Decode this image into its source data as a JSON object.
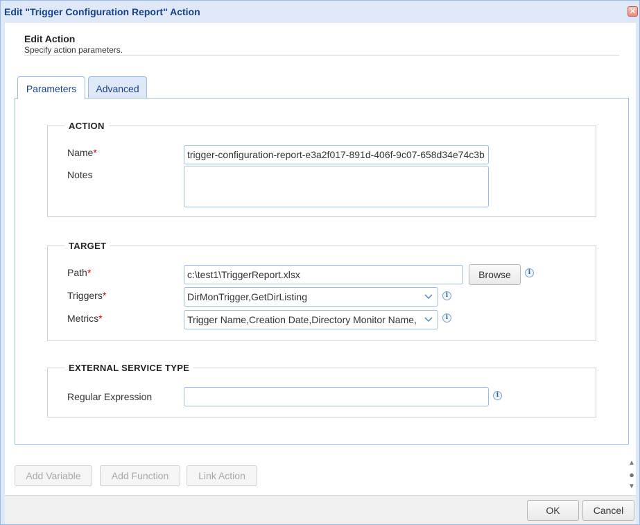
{
  "window": {
    "title": "Edit \"Trigger Configuration Report\" Action",
    "close_glyph": "✕"
  },
  "header": {
    "title": "Edit Action",
    "subtitle": "Specify action parameters."
  },
  "tabs": [
    {
      "label": "Parameters",
      "active": true
    },
    {
      "label": "Advanced",
      "active": false
    }
  ],
  "action_group": {
    "legend": "ACTION",
    "name_label": "Name",
    "name_value": "trigger-configuration-report-e3a2f017-891d-406f-9c07-658d34e74c3b",
    "notes_label": "Notes",
    "notes_value": ""
  },
  "target_group": {
    "legend": "TARGET",
    "path_label": "Path",
    "path_value": "c:\\test1\\TriggerReport.xlsx",
    "browse_label": "Browse",
    "triggers_label": "Triggers",
    "triggers_value": "DirMonTrigger,GetDirListing",
    "metrics_label": "Metrics",
    "metrics_value": "Trigger Name,Creation Date,Directory Monitor Name,"
  },
  "external_group": {
    "legend": "EXTERNAL SERVICE TYPE",
    "regex_label": "Regular Expression",
    "regex_value": ""
  },
  "required_marker": "*",
  "info_glyph": "i",
  "bottom_buttons": {
    "add_variable": "Add Variable",
    "add_function": "Add Function",
    "link_action": "Link Action"
  },
  "footer": {
    "ok": "OK",
    "cancel": "Cancel"
  },
  "icons": {
    "combo_arrow": "chevron-down-icon",
    "info": "info-icon",
    "close": "close-icon"
  },
  "colors": {
    "accent": "#15428b",
    "border": "#99bbe8",
    "window_bg": "#dfe8f6",
    "required": "#cc0000"
  }
}
